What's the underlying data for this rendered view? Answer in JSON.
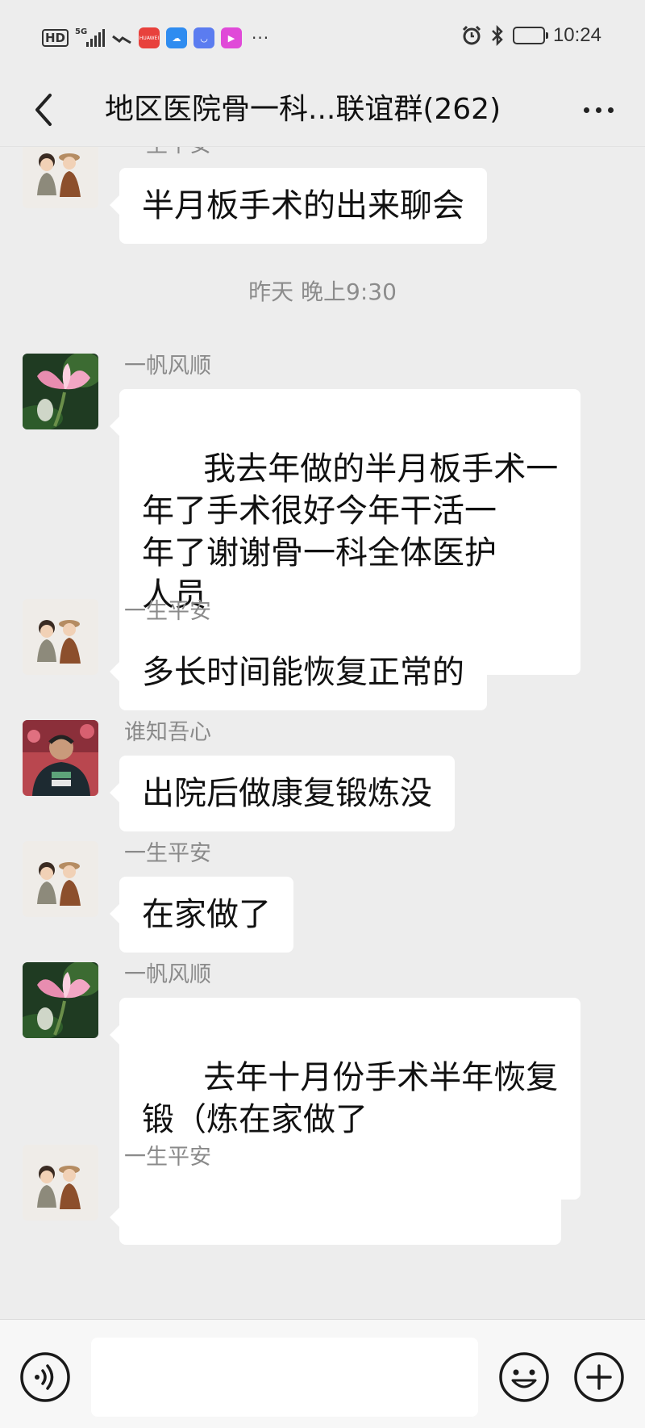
{
  "status_bar": {
    "hd": "HD",
    "network": "5G",
    "app_icons": [
      {
        "name": "huawei-app-icon",
        "label": "HUAWEI",
        "color": "#e8413c"
      },
      {
        "name": "cloud-app-icon",
        "label": "☁",
        "color": "#2f8cf0"
      },
      {
        "name": "store-app-icon",
        "label": "◡",
        "color": "#5b7cf0"
      },
      {
        "name": "video-app-icon",
        "label": "▶",
        "color": "#e04ad8"
      }
    ],
    "more": "···",
    "time": "10:24"
  },
  "header": {
    "title": "地区医院骨一科...联谊群(262)"
  },
  "messages": [
    {
      "sender": "一生平安",
      "avatar": "kids",
      "text": "半月板手术的出来聊会"
    },
    {
      "sender": "一帆风顺",
      "avatar": "lotus",
      "text": "我去年做的半月板手术一\n年了手术很好今年干活一\n年了谢谢骨一科全体医护\n人员"
    },
    {
      "sender": "一生平安",
      "avatar": "kids",
      "text": "多长时间能恢复正常的"
    },
    {
      "sender": "谁知吾心",
      "avatar": "man",
      "text": "出院后做康复锻炼没"
    },
    {
      "sender": "一生平安",
      "avatar": "kids",
      "text": "在家做了"
    },
    {
      "sender": "一帆风顺",
      "avatar": "lotus",
      "text": "去年十月份手术半年恢复\n锻（炼在家做了"
    },
    {
      "sender": "一生平安",
      "avatar": "kids",
      "text": ""
    }
  ],
  "time_separator": "昨天 晚上9:30",
  "input_bar": {
    "voice_icon": "voice-icon",
    "emoji_icon": "emoji-icon",
    "plus_icon": "plus-icon",
    "input_value": ""
  }
}
